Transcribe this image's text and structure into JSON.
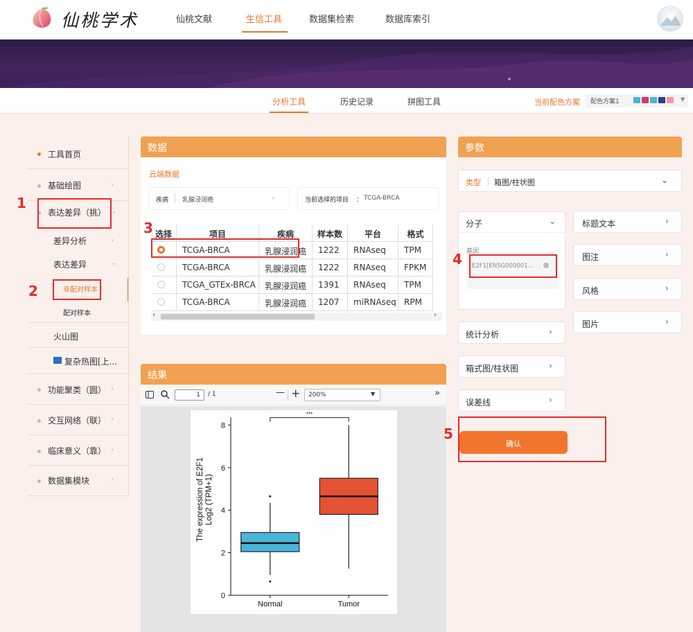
{
  "app": {
    "logo_text": "仙桃学术"
  },
  "nav": {
    "items": [
      "仙桃文献",
      "生信工具",
      "数据集检索",
      "数据库索引"
    ],
    "active": "生信工具"
  },
  "subnav": {
    "items": [
      "分析工具",
      "历史记录",
      "拼图工具"
    ],
    "active": "分析工具",
    "scheme_label": "当前配色方案",
    "scheme_value": "配色方案1"
  },
  "colors": {
    "accent": "#e8772e",
    "panel_header": "#f0a152",
    "annotation": "#e52b2b",
    "normal_box": "#4ab5d8",
    "tumor_box": "#e55234",
    "swatches": [
      "#4ab5d8",
      "#e0306b",
      "#4ab5d8",
      "#2f3e8c",
      "#f39a9a"
    ]
  },
  "sidebar": {
    "items": [
      {
        "label": "工具首页"
      },
      {
        "label": "基础绘图"
      },
      {
        "label": "表达差异（挑）"
      },
      {
        "label": "差异分析"
      },
      {
        "label": "表达差异"
      },
      {
        "label": "非配对样本"
      },
      {
        "label": "配对样本"
      },
      {
        "label": "火山图"
      },
      {
        "label": "复杂热图[上..."
      },
      {
        "label": "功能聚类（圆）"
      },
      {
        "label": "交互网络（联）"
      },
      {
        "label": "临床意义（靠）"
      },
      {
        "label": "数据集模块"
      }
    ]
  },
  "data_panel": {
    "title": "数据",
    "cloud_label": "云端数据",
    "disease_label": "疾病",
    "disease_value": "乳腺浸润癌",
    "project_label": "当前选择的项目",
    "project_sep": "：",
    "project_value": "TCGA-BRCA",
    "columns": [
      "选择",
      "项目",
      "疾病",
      "样本数",
      "平台",
      "格式"
    ],
    "rows": [
      {
        "project": "TCGA-BRCA",
        "disease": "乳腺浸润癌",
        "samples": "1222",
        "platform": "RNAseq",
        "format": "TPM",
        "selected": true
      },
      {
        "project": "TCGA-BRCA",
        "disease": "乳腺浸润癌",
        "samples": "1222",
        "platform": "RNAseq",
        "format": "FPKM",
        "selected": false
      },
      {
        "project": "TCGA_GTEx-BRCA",
        "disease": "乳腺浸润癌",
        "samples": "1391",
        "platform": "RNAseq",
        "format": "TPM",
        "selected": false
      },
      {
        "project": "TCGA-BRCA",
        "disease": "乳腺浸润癌",
        "samples": "1207",
        "platform": "miRNAseq",
        "format": "RPM",
        "selected": false
      }
    ]
  },
  "result_panel": {
    "title": "结果",
    "page_current": "1",
    "page_total": "/ 1",
    "zoom": "200%",
    "minus": "—",
    "plus": "+"
  },
  "chart_data": {
    "type": "boxplot",
    "categories": [
      "Normal",
      "Tumor"
    ],
    "ylabel_line1": "The expression of E2F1",
    "ylabel_line2": "Log2 (TPM+1)",
    "ylim": [
      0,
      8.5
    ],
    "yticks": [
      "0",
      "2",
      "4",
      "6",
      "8"
    ],
    "significance": "***",
    "boxes": [
      {
        "name": "Normal",
        "whisker_low": 0.95,
        "q1": 2.05,
        "median": 2.45,
        "q3": 2.95,
        "whisker_high": 4.35,
        "outliers": [
          0.65,
          4.65
        ]
      },
      {
        "name": "Tumor",
        "whisker_low": 1.25,
        "q1": 3.8,
        "median": 4.65,
        "q3": 5.5,
        "whisker_high": 8.0,
        "outliers": []
      }
    ]
  },
  "param_panel": {
    "title": "参数",
    "type_label": "类型",
    "type_value": "箱图/柱状图",
    "molecule_label": "分子",
    "gene_label": "基因",
    "gene_value": "E2F1[ENSG000001...",
    "stat_label": "统计分析",
    "boxbar_label": "箱式图/柱状图",
    "errorbar_label": "误差线",
    "title_text_label": "标题文本",
    "legend_label": "图注",
    "style_label": "风格",
    "image_label": "图片",
    "confirm_label": "确认"
  },
  "annotations": [
    "1",
    "2",
    "3",
    "4",
    "5"
  ]
}
